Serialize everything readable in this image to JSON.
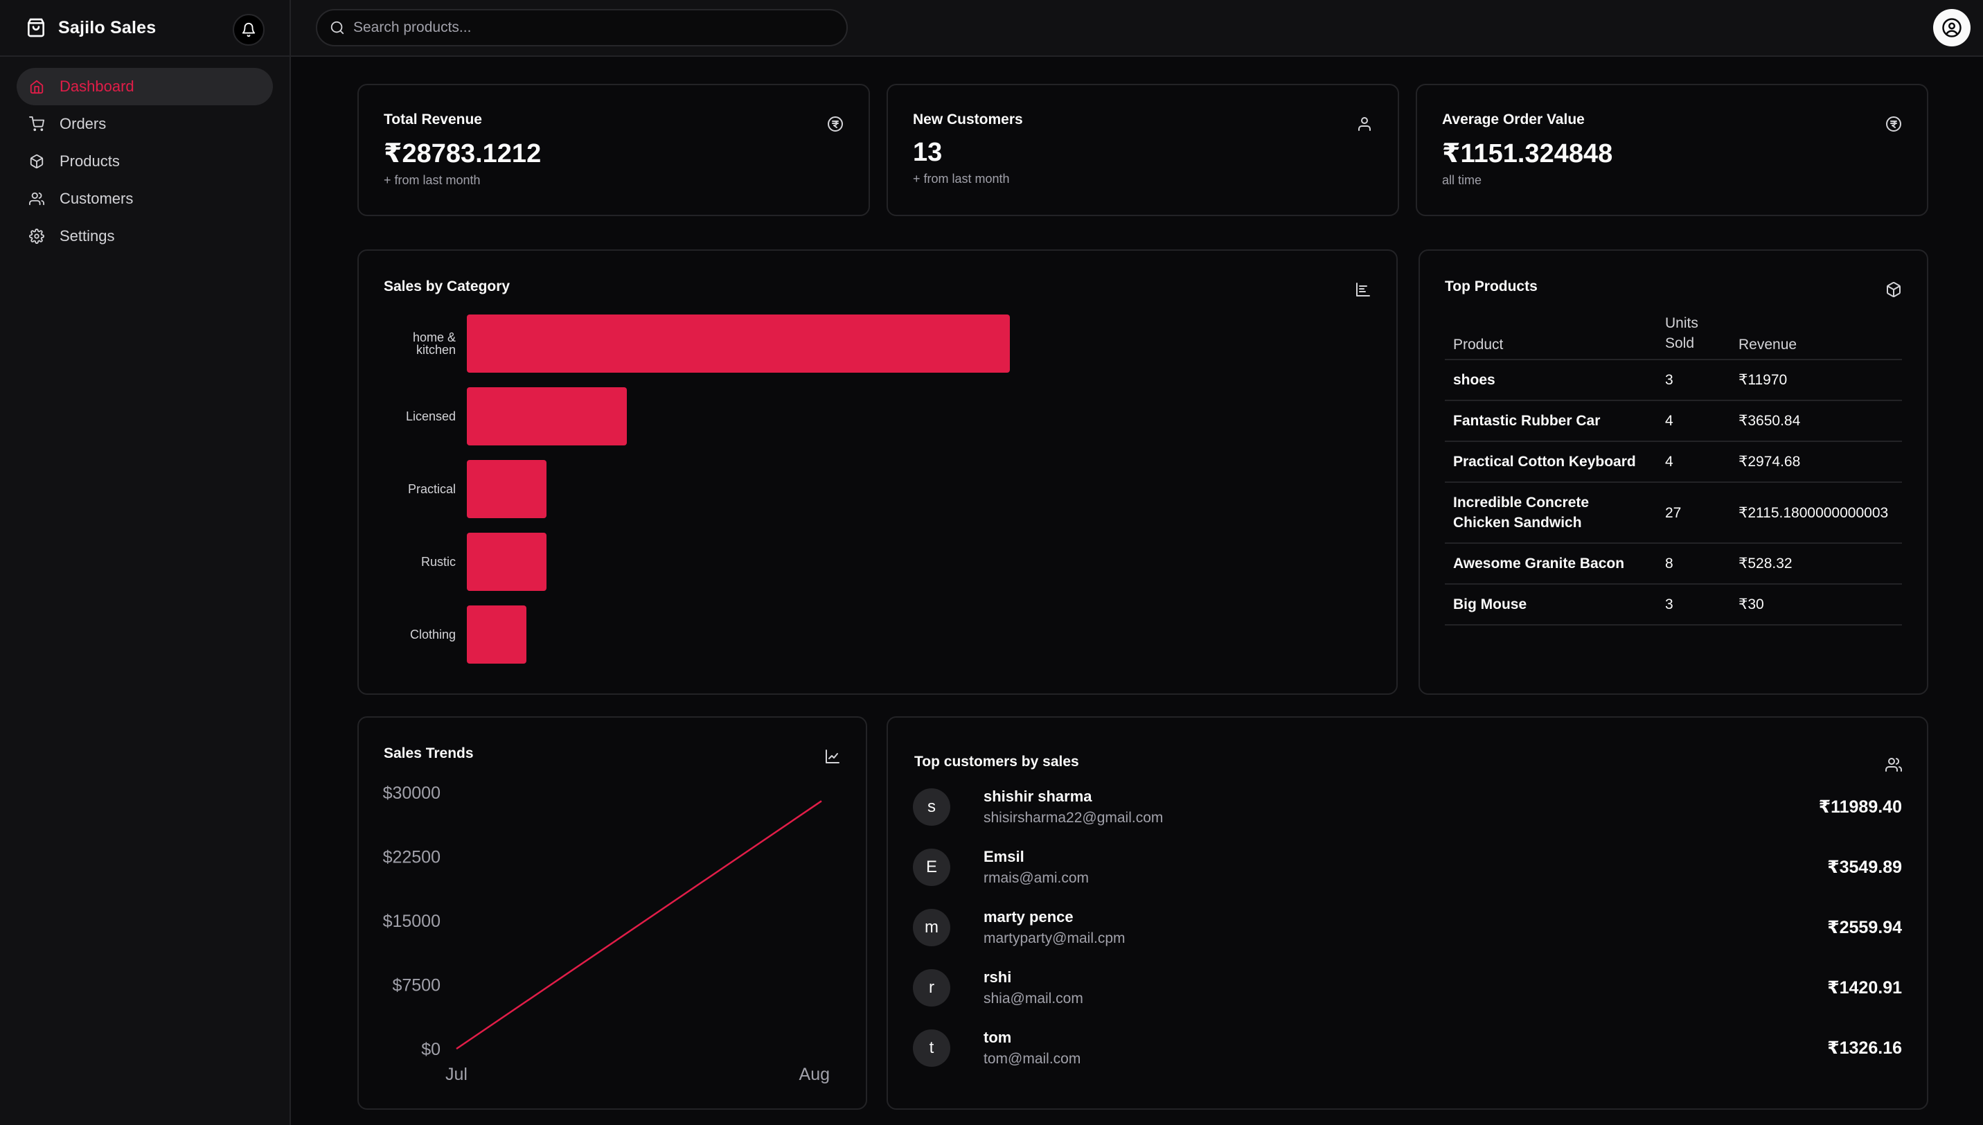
{
  "app": {
    "title": "Sajilo Sales"
  },
  "sidebar": {
    "items": [
      {
        "label": "Dashboard",
        "icon": "home-icon",
        "active": true
      },
      {
        "label": "Orders",
        "icon": "cart-icon"
      },
      {
        "label": "Products",
        "icon": "package-icon"
      },
      {
        "label": "Customers",
        "icon": "users-icon"
      },
      {
        "label": "Settings",
        "icon": "gear-icon"
      }
    ]
  },
  "search": {
    "placeholder": "Search products..."
  },
  "stats": [
    {
      "title": "Total Revenue",
      "value": "₹28783.1212",
      "sub": "+ from last month",
      "icon": "currency-icon"
    },
    {
      "title": "New Customers",
      "value": "13",
      "sub": "+ from last month",
      "icon": "user-icon"
    },
    {
      "title": "Average Order Value",
      "value": "₹1151.324848",
      "sub": "all time",
      "icon": "currency-icon"
    }
  ],
  "sales_by_category": {
    "title": "Sales by Category",
    "icon": "bar-chart-icon"
  },
  "top_products": {
    "title": "Top Products",
    "icon": "package-icon",
    "columns": [
      "Product",
      "Units Sold",
      "Revenue"
    ],
    "rows": [
      {
        "product": "shoes",
        "units": "3",
        "revenue": "₹11970"
      },
      {
        "product": "Fantastic Rubber Car",
        "units": "4",
        "revenue": "₹3650.84"
      },
      {
        "product": "Practical Cotton Keyboard",
        "units": "4",
        "revenue": "₹2974.68"
      },
      {
        "product": "Incredible Concrete Chicken Sandwich",
        "units": "27",
        "revenue": "₹2115.1800000000003"
      },
      {
        "product": "Awesome Granite Bacon",
        "units": "8",
        "revenue": "₹528.32"
      },
      {
        "product": "Big Mouse",
        "units": "3",
        "revenue": "₹30"
      }
    ]
  },
  "sales_trends": {
    "title": "Sales Trends",
    "icon": "line-chart-icon"
  },
  "top_customers": {
    "title": "Top customers by sales",
    "icon": "users-icon",
    "rows": [
      {
        "initial": "s",
        "name": "shishir sharma",
        "email": "shisirsharma22@gmail.com",
        "amount": "₹11989.40"
      },
      {
        "initial": "E",
        "name": "Emsil",
        "email": "rmais@ami.com",
        "amount": "₹3549.89"
      },
      {
        "initial": "m",
        "name": "marty pence",
        "email": "martyparty@mail.cpm",
        "amount": "₹2559.94"
      },
      {
        "initial": "r",
        "name": "rshi",
        "email": "shia@mail.com",
        "amount": "₹1420.91"
      },
      {
        "initial": "t",
        "name": "tom",
        "email": "tom@mail.com",
        "amount": "₹1326.16"
      }
    ]
  },
  "colors": {
    "accent": "#e11d48",
    "background": "#09090b",
    "border": "#232326"
  },
  "chart_data": [
    {
      "type": "bar",
      "orientation": "horizontal",
      "title": "Sales by Category",
      "categories": [
        "home & kitchen",
        "Licensed",
        "Practical",
        "Rustic",
        "Clothing"
      ],
      "values": [
        13600,
        4000,
        2000,
        2000,
        1500
      ],
      "grid": false
    },
    {
      "type": "line",
      "title": "Sales Trends",
      "x": [
        "Jul",
        "Aug"
      ],
      "values": [
        0,
        29000
      ],
      "yticks": [
        "$0",
        "$7500",
        "$15000",
        "$22500",
        "$30000"
      ],
      "ylim": [
        0,
        30000
      ],
      "grid": false
    }
  ]
}
